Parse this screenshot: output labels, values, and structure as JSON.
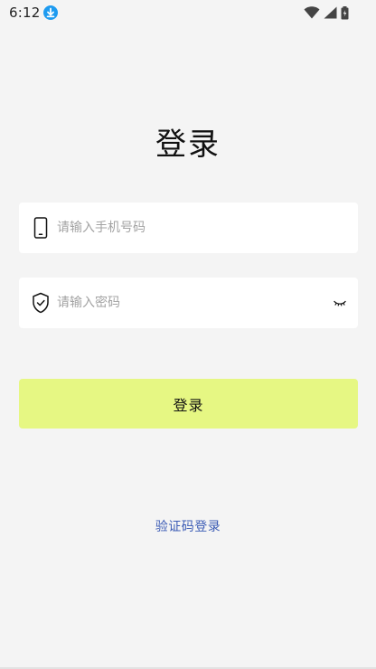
{
  "status_bar": {
    "time": "6:12",
    "icons": [
      "download-icon",
      "wifi-icon",
      "signal-icon",
      "battery-icon"
    ]
  },
  "page": {
    "title": "登录"
  },
  "phone_field": {
    "icon": "phone-icon",
    "value": "",
    "placeholder": "请输入手机号码"
  },
  "password_field": {
    "icon": "shield-icon",
    "value": "",
    "placeholder": "请输入密码",
    "toggle_icon": "eye-closed-icon"
  },
  "login_button": {
    "label": "登录",
    "color": "#e6f783"
  },
  "sms_login": {
    "label": "验证码登录",
    "color": "#3b5bb5"
  }
}
